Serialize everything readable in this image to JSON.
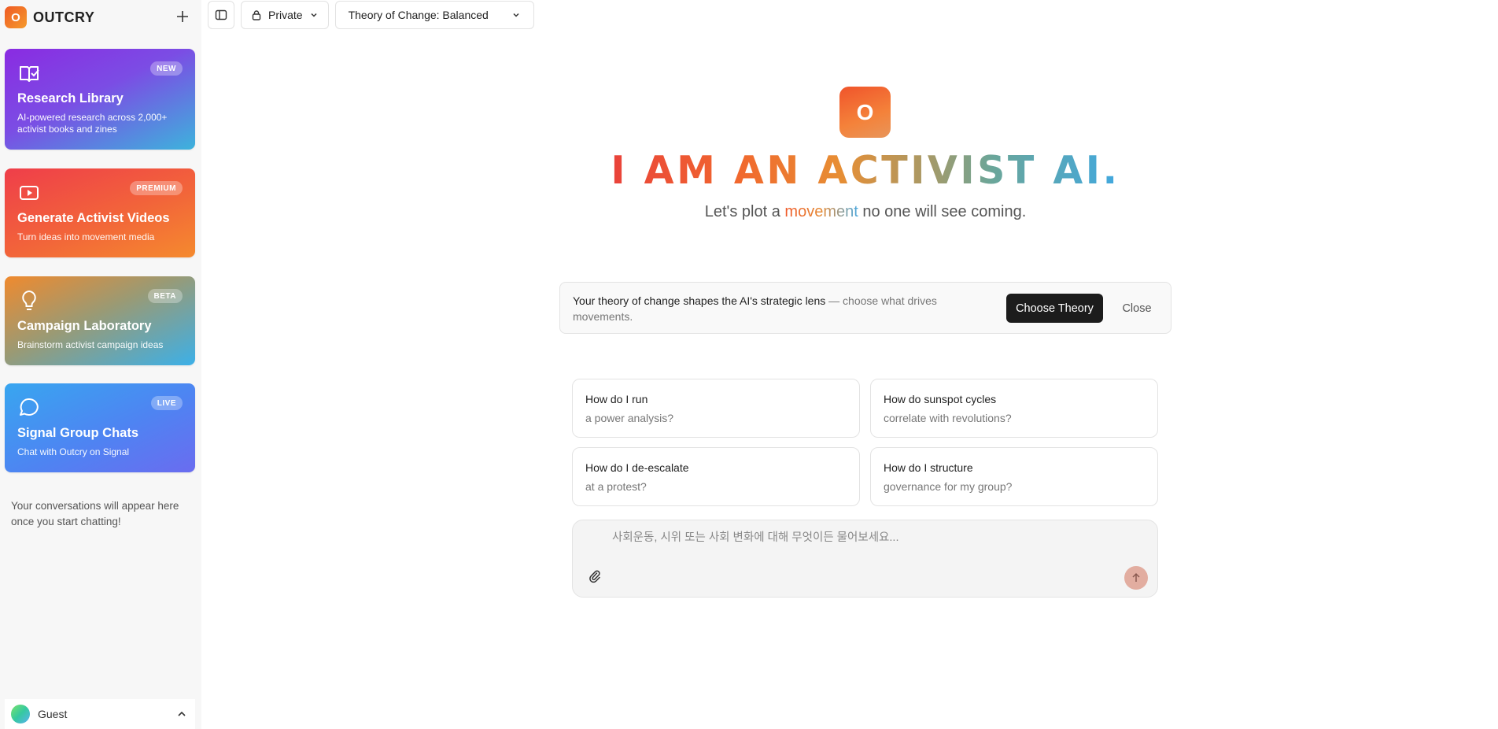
{
  "brand": {
    "logo_letter": "O",
    "name": "OUTCRY"
  },
  "sidebar": {
    "cards": [
      {
        "title": "Research Library",
        "badge": "NEW",
        "description": "AI-powered research across 2,000+ activist books and zines",
        "icon": "book-check-icon"
      },
      {
        "title": "Generate Activist Videos",
        "badge": "PREMIUM",
        "description": "Turn ideas into movement media",
        "icon": "video-play-icon"
      },
      {
        "title": "Campaign Laboratory",
        "badge": "BETA",
        "description": "Brainstorm activist campaign ideas",
        "icon": "lightbulb-icon"
      },
      {
        "title": "Signal Group Chats",
        "badge": "LIVE",
        "description": "Chat with Outcry on Signal",
        "icon": "chat-bubble-icon"
      }
    ],
    "empty_message": "Your conversations will appear here once you start chatting!",
    "user": {
      "name": "Guest"
    }
  },
  "topbar": {
    "visibility_label": "Private",
    "theory_label": "Theory of Change: Balanced"
  },
  "hero": {
    "logo_letter": "O",
    "title": "I AM AN ACTIVIST AI.",
    "subtitle_before": "Let's plot a ",
    "subtitle_highlight": "movement",
    "subtitle_after": " no one will see coming."
  },
  "notice": {
    "bold": "Your theory of change shapes the AI's strategic lens",
    "rest": " — choose what drives movements.",
    "choose_label": "Choose Theory",
    "close_label": "Close"
  },
  "suggestions": [
    {
      "line1": "How do I run",
      "line2": "a power analysis?"
    },
    {
      "line1": "How do sunspot cycles",
      "line2": "correlate with revolutions?"
    },
    {
      "line1": "How do I de-escalate",
      "line2": "at a protest?"
    },
    {
      "line1": "How do I structure",
      "line2": "governance for my group?"
    }
  ],
  "chat": {
    "placeholder": "사회운동, 시위 또는 사회 변화에 대해 무엇이든 물어보세요..."
  },
  "colors": {
    "accent_orange": "#ef5a24",
    "button_dark": "#1c1c1c",
    "send_button": "#e2ada0"
  }
}
